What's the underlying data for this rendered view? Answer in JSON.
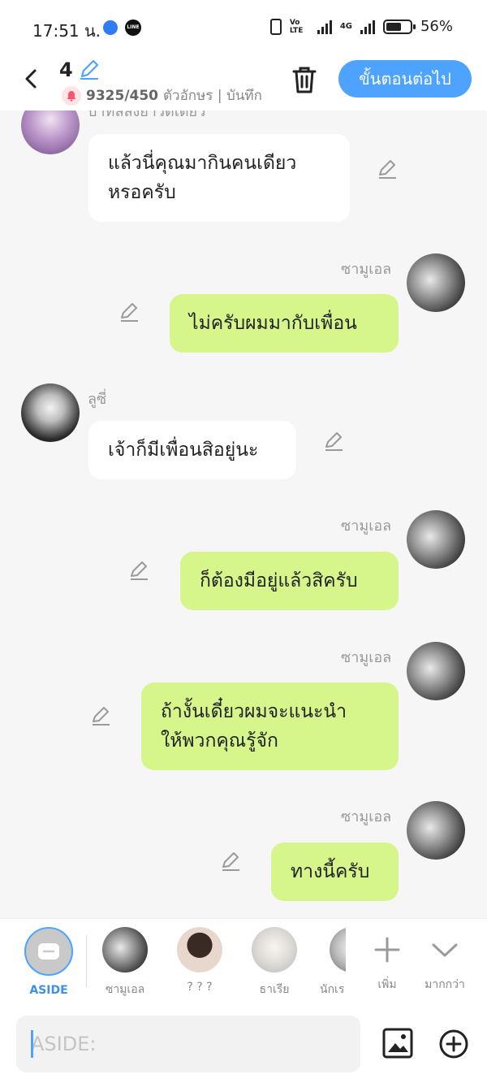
{
  "status_bar": {
    "time": "17:51 น.",
    "volte": "Vo LTE",
    "net": "4G",
    "battery": "56%"
  },
  "header": {
    "episode": "4",
    "char_count": "9325/450",
    "count_suffix": "ตัวอักษร | บันทึก",
    "next_label": "ขั้นตอนต่อไป"
  },
  "messages": [
    {
      "side": "left",
      "text": "แล้วนี่คุณมากินคนเดียวหรอครับ",
      "lines": [
        "แล้วนี่คุณมากินคนเดียว",
        "หรอครับ"
      ],
      "cut_name": "บาทัลล้งยาวดเดียว"
    },
    {
      "side": "right",
      "name": "ซามูเอล",
      "text": "ไม่ครับผมมากับเพื่อน"
    },
    {
      "side": "left",
      "name": "ลูซี่",
      "text": "เจ้าก็มีเพื่อนสิอยู่นะ"
    },
    {
      "side": "right",
      "name": "ซามูเอล",
      "text": "ก็ต้องมีอยู่แล้วสิครับ"
    },
    {
      "side": "right",
      "name": "ซามูเอล",
      "lines": [
        "ถ้างั้นเดี๋ยวผมจะแนะนำ",
        "ให้พวกคุณรู้จัก"
      ]
    },
    {
      "side": "right",
      "name": "ซามูเอล",
      "text": "ทางนี้ครับ"
    }
  ],
  "characters": [
    {
      "label": "ASIDE"
    },
    {
      "label": "ซามูเอล"
    },
    {
      "label": "? ? ?"
    },
    {
      "label": "ธาเรีย"
    },
    {
      "label": "นักเร"
    },
    {
      "label": "เพิ่ม"
    },
    {
      "label": "มากกว่า"
    }
  ],
  "composer": {
    "placeholder": "ASIDE:"
  },
  "colors": {
    "accent": "#4da3ff",
    "bubble_green": "#d6f58b",
    "bubble_white": "#ffffff"
  }
}
